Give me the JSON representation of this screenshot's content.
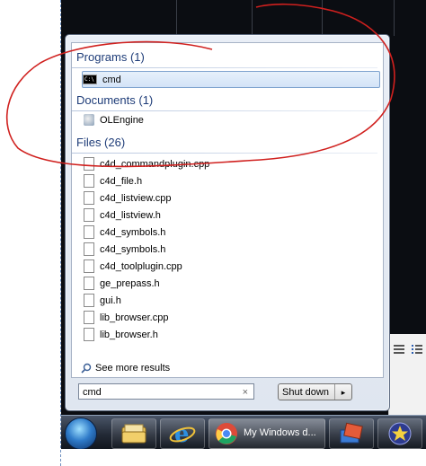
{
  "start_menu": {
    "groups": [
      {
        "header": "Programs (1)",
        "items": [
          {
            "label": "cmd",
            "icon": "cmd-icon",
            "selected": true
          }
        ]
      },
      {
        "header": "Documents (1)",
        "items": [
          {
            "label": "OLEngine",
            "icon": "document-icon"
          }
        ]
      },
      {
        "header": "Files (26)",
        "items": [
          {
            "label": "c4d_commandplugin.cpp"
          },
          {
            "label": "c4d_file.h"
          },
          {
            "label": "c4d_listview.cpp"
          },
          {
            "label": "c4d_listview.h"
          },
          {
            "label": "c4d_symbols.h"
          },
          {
            "label": "c4d_symbols.h"
          },
          {
            "label": "c4d_toolplugin.cpp"
          },
          {
            "label": "ge_prepass.h"
          },
          {
            "label": "gui.h"
          },
          {
            "label": "lib_browser.cpp"
          },
          {
            "label": "lib_browser.h"
          }
        ]
      }
    ],
    "see_more": "See more results",
    "search": {
      "value": "cmd",
      "clear_glyph": "×"
    },
    "shutdown": {
      "label": "Shut down",
      "arrow": "▸"
    }
  },
  "taskbar": {
    "items": [
      {
        "icon": "start-orb-icon"
      },
      {
        "icon": "explorer-folder-icon"
      },
      {
        "icon": "internet-explorer-icon"
      },
      {
        "icon": "chrome-icon",
        "label": "My Windows d..."
      },
      {
        "icon": "app-icon"
      },
      {
        "icon": "star-app-icon"
      }
    ]
  },
  "colors": {
    "annotation": "#d0201e",
    "group_header": "#1e3c78",
    "selection": "#d3e3f7"
  }
}
